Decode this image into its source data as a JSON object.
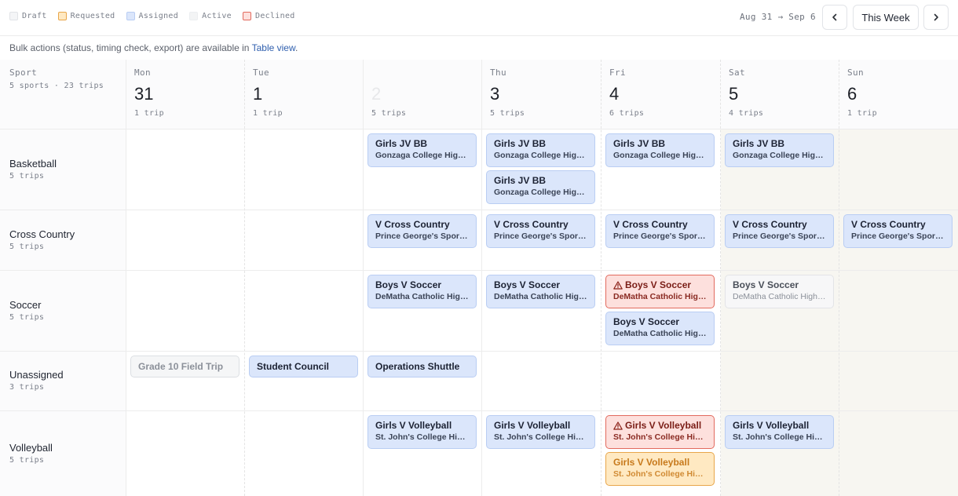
{
  "legend": [
    {
      "label": "Draft",
      "status": "draft"
    },
    {
      "label": "Requested",
      "status": "requested"
    },
    {
      "label": "Assigned",
      "status": "assigned"
    },
    {
      "label": "Active",
      "status": "active"
    },
    {
      "label": "Declined",
      "status": "declined"
    }
  ],
  "toolbar": {
    "range": "Aug 31 → Sep 6",
    "this_week": "This Week"
  },
  "bulk": {
    "text": "Bulk actions (status, timing check, export) are available in ",
    "link": "Table view",
    "end": "."
  },
  "corner": {
    "title": "Sport",
    "summary": "5 sports · 23 trips"
  },
  "days": [
    {
      "name": "Mon",
      "num": "31",
      "trips": "1 trip"
    },
    {
      "name": "Tue",
      "num": "1",
      "trips": "1 trip"
    },
    {
      "name": "",
      "num": "2",
      "trips": "5 trips"
    },
    {
      "name": "Thu",
      "num": "3",
      "trips": "5 trips"
    },
    {
      "name": "Fri",
      "num": "4",
      "trips": "6 trips"
    },
    {
      "name": "Sat",
      "num": "5",
      "trips": "4 trips"
    },
    {
      "name": "Sun",
      "num": "6",
      "trips": "1 trip"
    }
  ],
  "sports": [
    {
      "name": "Basketball",
      "trips": "5 trips"
    },
    {
      "name": "Cross Country",
      "trips": "5 trips"
    },
    {
      "name": "Soccer",
      "trips": "5 trips"
    },
    {
      "name": "Unassigned",
      "trips": "3 trips"
    },
    {
      "name": "Volleyball",
      "trips": "5 trips"
    }
  ],
  "trips": [
    {
      "row": 0,
      "day": 2,
      "slot": 0,
      "status": "assigned",
      "title": "Girls JV BB",
      "sub": "Gonzaga College High School"
    },
    {
      "row": 0,
      "day": 3,
      "slot": 0,
      "status": "assigned",
      "title": "Girls JV BB",
      "sub": "Gonzaga College High School"
    },
    {
      "row": 0,
      "day": 3,
      "slot": 1,
      "status": "assigned",
      "title": "Girls JV BB",
      "sub": "Gonzaga College High School"
    },
    {
      "row": 0,
      "day": 4,
      "slot": 0,
      "status": "assigned",
      "title": "Girls JV BB",
      "sub": "Gonzaga College High School"
    },
    {
      "row": 0,
      "day": 5,
      "slot": 0,
      "status": "assigned",
      "title": "Girls JV BB",
      "sub": "Gonzaga College High School"
    },
    {
      "row": 1,
      "day": 2,
      "slot": 0,
      "status": "assigned",
      "title": "V Cross Country",
      "sub": "Prince George's Sports Complex"
    },
    {
      "row": 1,
      "day": 3,
      "slot": 0,
      "status": "assigned",
      "title": "V Cross Country",
      "sub": "Prince George's Sports Complex"
    },
    {
      "row": 1,
      "day": 4,
      "slot": 0,
      "status": "assigned",
      "title": "V Cross Country",
      "sub": "Prince George's Sports Complex"
    },
    {
      "row": 1,
      "day": 5,
      "slot": 0,
      "status": "assigned",
      "title": "V Cross Country",
      "sub": "Prince George's Sports Complex"
    },
    {
      "row": 1,
      "day": 6,
      "slot": 0,
      "status": "assigned",
      "title": "V Cross Country",
      "sub": "Prince George's Sports Complex"
    },
    {
      "row": 2,
      "day": 2,
      "slot": 0,
      "status": "assigned",
      "title": "Boys V Soccer",
      "sub": "DeMatha Catholic High School"
    },
    {
      "row": 2,
      "day": 3,
      "slot": 0,
      "status": "assigned",
      "title": "Boys V Soccer",
      "sub": "DeMatha Catholic High School"
    },
    {
      "row": 2,
      "day": 4,
      "slot": 0,
      "status": "declined",
      "warning": true,
      "title": "Boys V Soccer",
      "sub": "DeMatha Catholic High School"
    },
    {
      "row": 2,
      "day": 4,
      "slot": 1,
      "status": "assigned",
      "title": "Boys V Soccer",
      "sub": "DeMatha Catholic High School"
    },
    {
      "row": 2,
      "day": 5,
      "slot": 0,
      "status": "active",
      "title": "Boys V Soccer",
      "sub": "DeMatha Catholic High School"
    },
    {
      "row": 3,
      "day": 0,
      "slot": 0,
      "status": "draft",
      "single": true,
      "title": "Grade 10 Field Trip",
      "sub": ""
    },
    {
      "row": 3,
      "day": 1,
      "slot": 0,
      "status": "assigned",
      "single": true,
      "title": "Student Council",
      "sub": ""
    },
    {
      "row": 3,
      "day": 2,
      "slot": 0,
      "status": "assigned",
      "single": true,
      "title": "Operations Shuttle",
      "sub": ""
    },
    {
      "row": 4,
      "day": 2,
      "slot": 0,
      "status": "assigned",
      "title": "Girls V Volleyball",
      "sub": "St. John's College High School"
    },
    {
      "row": 4,
      "day": 3,
      "slot": 0,
      "status": "assigned",
      "title": "Girls V Volleyball",
      "sub": "St. John's College High School"
    },
    {
      "row": 4,
      "day": 4,
      "slot": 0,
      "status": "declined",
      "warning": true,
      "title": "Girls V Volleyball",
      "sub": "St. John's College High School"
    },
    {
      "row": 4,
      "day": 4,
      "slot": 1,
      "status": "requested",
      "title": "Girls V Volleyball",
      "sub": "St. John's College High School"
    },
    {
      "row": 4,
      "day": 5,
      "slot": 0,
      "status": "assigned",
      "title": "Girls V Volleyball",
      "sub": "St. John's College High School"
    }
  ]
}
